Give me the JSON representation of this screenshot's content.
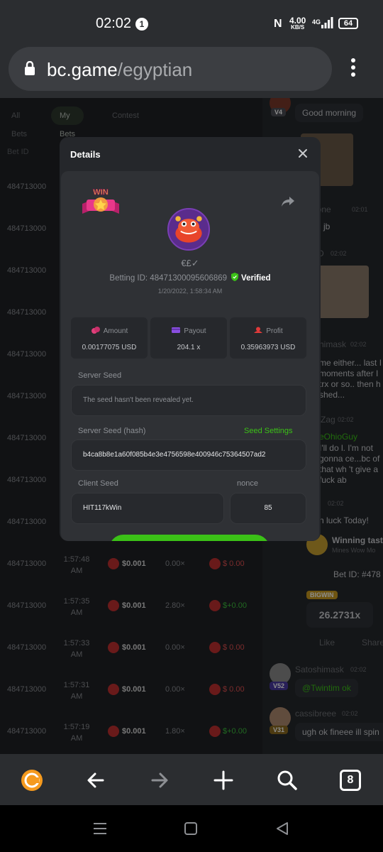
{
  "status_bar": {
    "time": "02:02",
    "notification_count": "1",
    "speed_value": "4.00",
    "speed_unit": "KB/S",
    "network": "4G",
    "battery": "64"
  },
  "browser": {
    "url_host": "bc.game",
    "url_path": "/egyptian",
    "tab_count": "8"
  },
  "background_page": {
    "tabs": [
      "All Bets",
      "My Bets",
      "Contest"
    ],
    "active_tab": "My Bets",
    "bet_id_header": "Bet ID",
    "rows": [
      {
        "id": "484713000",
        "time": "",
        "amount": "",
        "multiplier": "",
        "payout": ""
      },
      {
        "id": "484713000",
        "time": "",
        "amount": "",
        "multiplier": "",
        "payout": ""
      },
      {
        "id": "484713000",
        "time": "",
        "amount": "",
        "multiplier": "",
        "payout": ""
      },
      {
        "id": "484713000",
        "time": "",
        "amount": "",
        "multiplier": "",
        "payout": ""
      },
      {
        "id": "484713000",
        "time": "",
        "amount": "",
        "multiplier": "",
        "payout": ""
      },
      {
        "id": "484713000",
        "time": "",
        "amount": "",
        "multiplier": "",
        "payout": ""
      },
      {
        "id": "484713000",
        "time": "",
        "amount": "",
        "multiplier": "",
        "payout": ""
      },
      {
        "id": "484713000",
        "time": "",
        "amount": "",
        "multiplier": "",
        "payout": ""
      },
      {
        "id": "484713000",
        "time": "",
        "amount": "",
        "multiplier": "",
        "payout": ""
      },
      {
        "id": "484713000",
        "time": "1:57:48 AM",
        "amount": "$0.001",
        "multiplier": "0.00×",
        "payout": "$  0.00",
        "positive": false
      },
      {
        "id": "484713000",
        "time": "1:57:35 AM",
        "amount": "$0.001",
        "multiplier": "2.80×",
        "payout": "$+0.00",
        "positive": true
      },
      {
        "id": "484713000",
        "time": "1:57:33 AM",
        "amount": "$0.001",
        "multiplier": "0.00×",
        "payout": "$  0.00",
        "positive": false
      },
      {
        "id": "484713000",
        "time": "1:57:31 AM",
        "amount": "$0.001",
        "multiplier": "0.00×",
        "payout": "$  0.00",
        "positive": false
      },
      {
        "id": "484713000",
        "time": "1:57:19 AM",
        "amount": "$0.001",
        "multiplier": "1.80×",
        "payout": "$+0.00",
        "positive": true
      }
    ],
    "chat": {
      "good_morning": "Good morning",
      "level_v4": "V4",
      "user_lone": "lone",
      "time_2001": "02:01",
      "msg_gjb": "g jb",
      "d_prefix": "D",
      "time_2002a": "02:02",
      "user_shimask": "himask",
      "time_2002b": "02:02",
      "msg_long": "me either... last I moments after I trx or so.. then h shed...",
      "user_zag": "Zag",
      "time_2002c": "02:02",
      "mention": "eOhioGuy",
      "msg_notgonna": "I'll do l. I'm not gonna ce...bc of that wh 't give a fuck ab",
      "time_2002d": "02:02",
      "luck_today": "n luck Today!",
      "winning_title": "Winning tast",
      "winning_sub": "Mines Wow Mo",
      "bet_id_prefix": "Bet ID: #478",
      "bigwin": "BIGWIN",
      "bigwin_multiplier": "26.2731x",
      "like": "Like",
      "share": "Share",
      "user_satoshimask": "Satoshimask",
      "time_2002e": "02:02",
      "level_v52": "V52",
      "msg_twintim": "@Twintim ok",
      "user_cassibreee": "cassibreee",
      "time_2002f": "02:02",
      "level_v31": "V31",
      "msg_fineee": "ugh ok fineee ill spin"
    }
  },
  "details_modal": {
    "title": "Details",
    "win_label": "WIN",
    "currency": "€£✓",
    "betting_id_label": "Betting ID: 48471300095606869",
    "verified_label": "Verified",
    "date": "1/20/2022, 1:58:34 AM",
    "stats": [
      {
        "label": "Amount",
        "value": "0.00177075 USD",
        "icon": "coins-icon",
        "color": "#e0407a"
      },
      {
        "label": "Payout",
        "value": "204.1 x",
        "icon": "wallet-icon",
        "color": "#8a4fe0"
      },
      {
        "label": "Profit",
        "value": "0.35963973 USD",
        "icon": "profit-icon",
        "color": "#e03a3a"
      }
    ],
    "server_seed_label": "Server Seed",
    "server_seed_value": "The seed hasn't been revealed yet.",
    "server_seed_hash_label": "Server Seed (hash)",
    "seed_settings_label": "Seed Settings",
    "server_seed_hash_value": "b4ca8b8e1a60f085b4e3e4756598e400946c75364507ad2",
    "client_seed_label": "Client Seed",
    "client_seed_value": "HIT117kWin",
    "nonce_label": "nonce",
    "nonce_value": "85",
    "accent": "#3bc117"
  }
}
